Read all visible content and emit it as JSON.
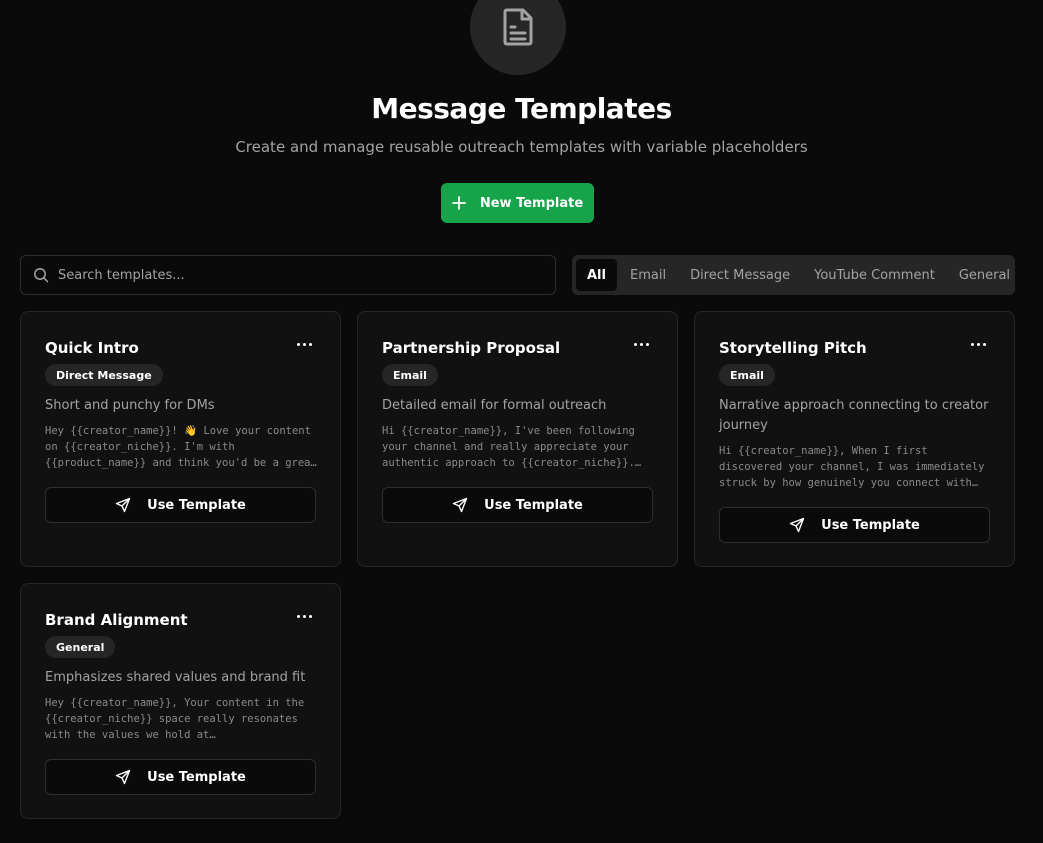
{
  "header": {
    "icon": "document-icon",
    "title": "Message Templates",
    "subtitle": "Create and manage reusable outreach templates with variable placeholders",
    "new_template_label": "New Template"
  },
  "search": {
    "placeholder": "Search templates...",
    "value": ""
  },
  "filters": [
    {
      "label": "All",
      "active": true
    },
    {
      "label": "Email",
      "active": false
    },
    {
      "label": "Direct Message",
      "active": false
    },
    {
      "label": "YouTube Comment",
      "active": false
    },
    {
      "label": "General",
      "active": false
    }
  ],
  "templates": [
    {
      "title": "Quick Intro",
      "category": "Direct Message",
      "description": "Short and punchy for DMs",
      "preview": "Hey {{creator_name}}! 👋 Love your content on {{creator_niche}}. I'm with {{product_name}} and think you'd be a great fit for a collaboration.",
      "action_label": "Use Template"
    },
    {
      "title": "Partnership Proposal",
      "category": "Email",
      "description": "Detailed email for formal outreach",
      "preview": "Hi {{creator_name}}, I've been following your channel and really appreciate your authentic approach to {{creator_niche}}. We'd love to explore a partnership.",
      "action_label": "Use Template"
    },
    {
      "title": "Storytelling Pitch",
      "category": "Email",
      "description": "Narrative approach connecting to creator journey",
      "preview": "Hi {{creator_name}}, When I first discovered your channel, I was immediately struck by how genuinely you connect with your audience.",
      "action_label": "Use Template"
    },
    {
      "title": "Brand Alignment",
      "category": "General",
      "description": "Emphasizes shared values and brand fit",
      "preview": "Hey {{creator_name}}, Your content in the {{creator_niche}} space really resonates with the values we hold at {{product_name}}.",
      "action_label": "Use Template"
    }
  ]
}
